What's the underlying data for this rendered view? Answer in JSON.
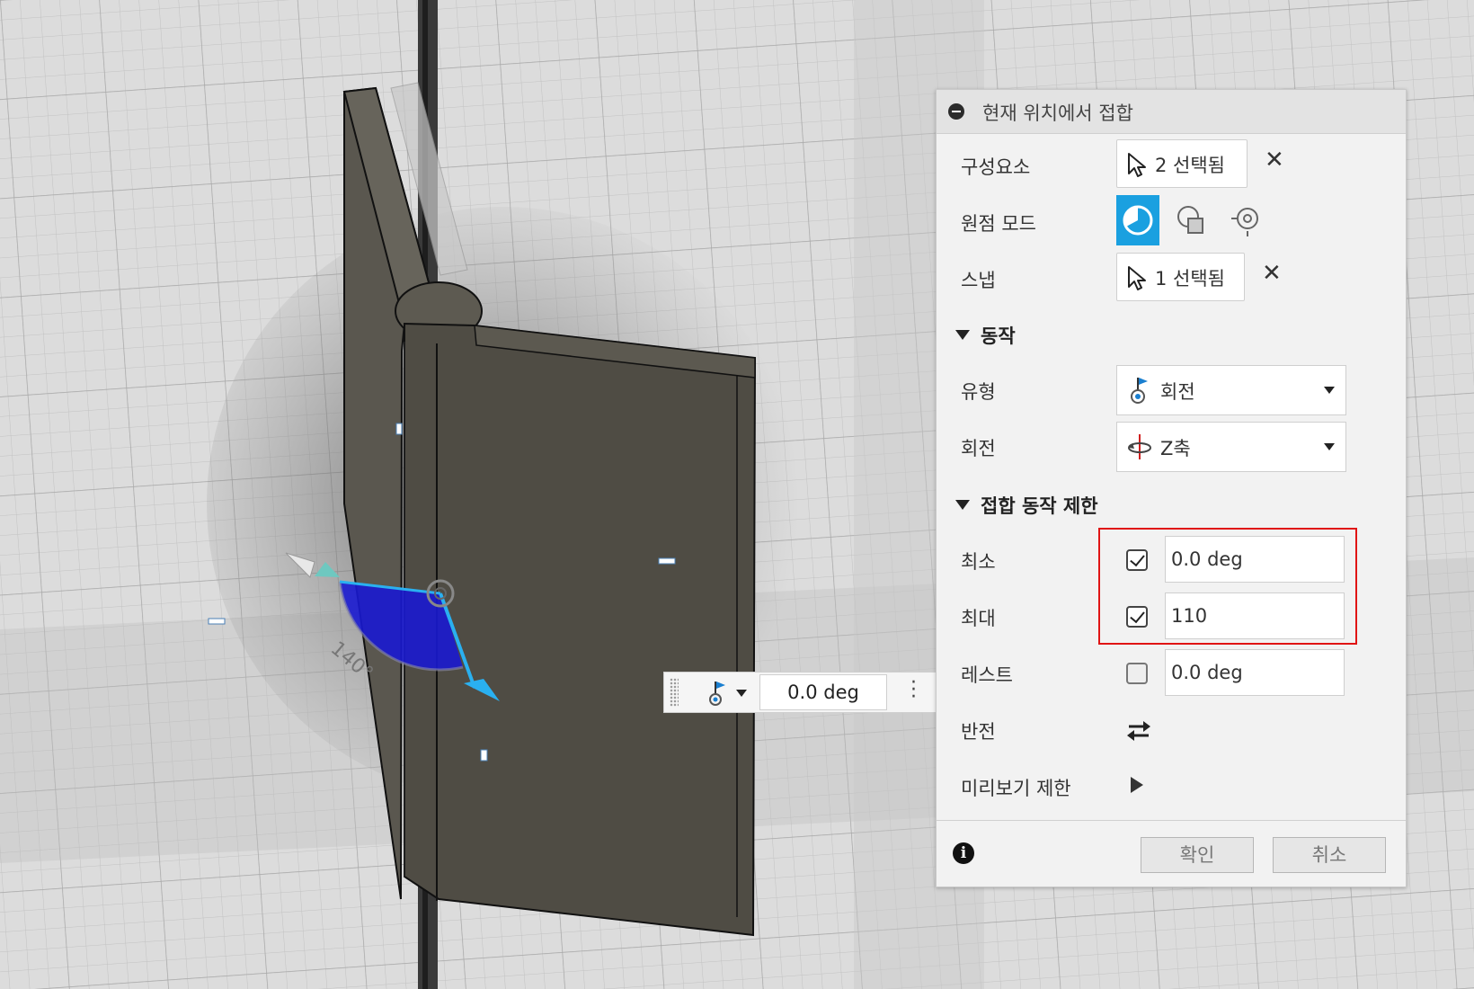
{
  "panel": {
    "title": "현재 위치에서 접합",
    "components": {
      "label": "구성요소",
      "value": "2 선택됨"
    },
    "origin_mode": {
      "label": "원점 모드"
    },
    "snap": {
      "label": "스냅",
      "value": "1 선택됨"
    },
    "motion": {
      "header": "동작",
      "type": {
        "label": "유형",
        "value": "회전"
      },
      "rotation": {
        "label": "회전",
        "value": "Z축"
      }
    },
    "limits": {
      "header": "접합 동작 제한",
      "min": {
        "label": "최소",
        "checked": true,
        "value": "0.0 deg"
      },
      "max": {
        "label": "최대",
        "checked": true,
        "value": "110"
      },
      "rest": {
        "label": "레스트",
        "checked": false,
        "value": "0.0 deg"
      }
    },
    "flip": {
      "label": "반전"
    },
    "preview": {
      "label": "미리보기 제한"
    },
    "ok_label": "확인",
    "cancel_label": "취소",
    "info_icon": "i"
  },
  "hud": {
    "value": "0.0 deg"
  },
  "viewport": {
    "angle_label": "140°"
  },
  "colors": {
    "accent": "#1aa0e0",
    "highlight": "#e01414",
    "joint_arc": "#1a1ad0",
    "body": "#4f4c44"
  }
}
